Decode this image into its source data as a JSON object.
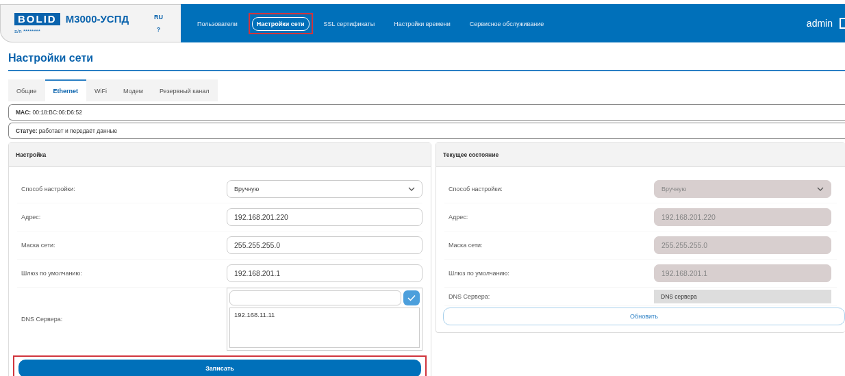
{
  "header": {
    "logo": "BOLID",
    "product": "М3000-УСПД",
    "serial": "s/n ********",
    "language": "RU",
    "help": "?",
    "user": "admin"
  },
  "nav": [
    {
      "label": "Пользователи",
      "selected": false,
      "highlighted": false
    },
    {
      "label": "Настройки сети",
      "selected": true,
      "highlighted": true
    },
    {
      "label": "SSL сертификаты",
      "selected": false,
      "highlighted": false
    },
    {
      "label": "Настройки времени",
      "selected": false,
      "highlighted": false
    },
    {
      "label": "Сервисное обслуживание",
      "selected": false,
      "highlighted": false
    }
  ],
  "page_title": "Настройки сети",
  "tabs": [
    {
      "label": "Общие",
      "selected": false
    },
    {
      "label": "Ethernet",
      "selected": true
    },
    {
      "label": "WiFi",
      "selected": false
    },
    {
      "label": "Модем",
      "selected": false
    },
    {
      "label": "Резервный канал",
      "selected": false
    }
  ],
  "info_rows": [
    {
      "label": "MAC:",
      "value": "00:18:BC:06:D6:52"
    },
    {
      "label": "Статус:",
      "value": "работает и передаёт данные"
    }
  ],
  "settings": {
    "title": "Настройка",
    "rows": [
      {
        "kind": "select",
        "label": "Способ настройки:",
        "value": "Вручную",
        "disabled": false
      },
      {
        "kind": "input",
        "label": "Адрес:",
        "value": "192.168.201.220",
        "disabled": false
      },
      {
        "kind": "input",
        "label": "Маска сети:",
        "value": "255.255.255.0",
        "disabled": false
      },
      {
        "kind": "input",
        "label": "Шлюз по умолчанию:",
        "value": "192.168.201.1",
        "disabled": false
      },
      {
        "kind": "dns_editor",
        "label": "DNS Сервера:",
        "entries": [
          "192.168.11.11"
        ]
      }
    ],
    "button": {
      "label": "Записать",
      "highlighted": true
    }
  },
  "current": {
    "title": "Текущее состояние",
    "rows": [
      {
        "kind": "select",
        "label": "Способ настройки:",
        "value": "Вручную",
        "disabled": true
      },
      {
        "kind": "input",
        "label": "Адрес:",
        "value": "192.168.201.220",
        "disabled": true
      },
      {
        "kind": "input",
        "label": "Маска сети:",
        "value": "255.255.255.0",
        "disabled": true
      },
      {
        "kind": "input",
        "label": "Шлюз по умолчанию:",
        "value": "192.168.201.1",
        "disabled": true
      },
      {
        "kind": "dns_list",
        "label": "DNS Сервера:",
        "value": "DNS сервера"
      }
    ],
    "button": {
      "label": "Обновить"
    }
  }
}
